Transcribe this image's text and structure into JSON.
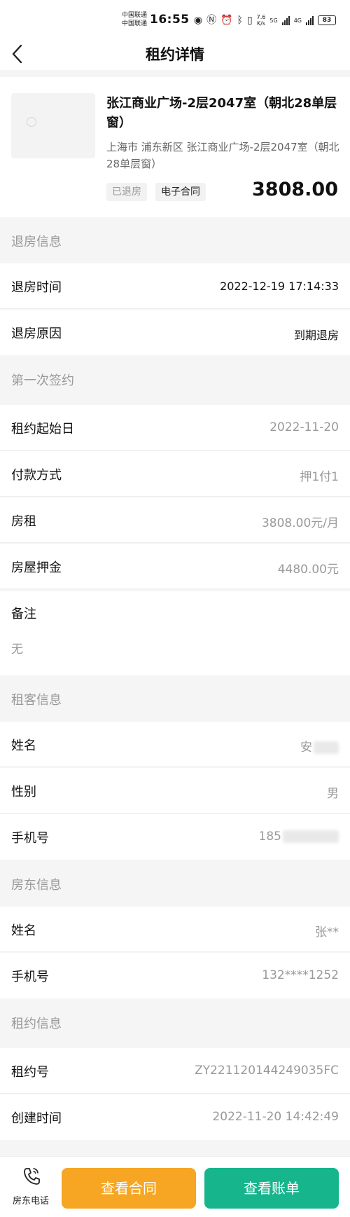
{
  "status_bar": {
    "carrier_1": "中国联通",
    "carrier_2": "中国联通",
    "time": "16:55",
    "net_speed_value": "7.6",
    "net_speed_unit": "K/s",
    "signal_1_label": "5G",
    "signal_2_label": "4G",
    "battery": "83",
    "icons": [
      "eye-icon",
      "nfc-icon",
      "alarm-icon",
      "bluetooth-icon",
      "vibrate-icon"
    ]
  },
  "nav": {
    "title": "租约详情",
    "back_icon": "chevron-left-icon"
  },
  "house": {
    "title": "张江商业广场-2层2047室（朝北28单层窗）",
    "address": "上海市 浦东新区 张江商业广场-2层2047室（朝北28单层窗）",
    "status_badge": "已退房",
    "contract_badge": "电子合同",
    "price": "3808.00"
  },
  "checkout": {
    "header": "退房信息",
    "time_label": "退房时间",
    "time_value": "2022-12-19 17:14:33",
    "reason_label": "退房原因",
    "reason_value": "到期退房"
  },
  "first_sign": {
    "header": "第一次签约",
    "start_label": "租约起始日",
    "start_value": "2022-11-20",
    "payment_label": "付款方式",
    "payment_value": "押1付1",
    "rent_label": "房租",
    "rent_value": "3808.00元/月",
    "deposit_label": "房屋押金",
    "deposit_value": "4480.00元",
    "remark_label": "备注",
    "remark_value": "无"
  },
  "tenant": {
    "header": "租客信息",
    "name_label": "姓名",
    "name_value": "安",
    "gender_label": "性别",
    "gender_value": "男",
    "phone_label": "手机号",
    "phone_value": "185"
  },
  "landlord": {
    "header": "房东信息",
    "name_label": "姓名",
    "name_value": "张**",
    "phone_label": "手机号",
    "phone_value": "132****1252"
  },
  "lease": {
    "header": "租约信息",
    "number_label": "租约号",
    "number_value": "ZY221120144249035FC",
    "created_label": "创建时间",
    "created_value": "2022-11-20 14:42:49"
  },
  "bottom_bar": {
    "phone_label": "房东电话",
    "phone_icon": "phone-icon",
    "contract_button": "查看合同",
    "bill_button": "查看账单"
  },
  "colors": {
    "accent_orange": "#f6a623",
    "accent_green": "#16b58c"
  }
}
